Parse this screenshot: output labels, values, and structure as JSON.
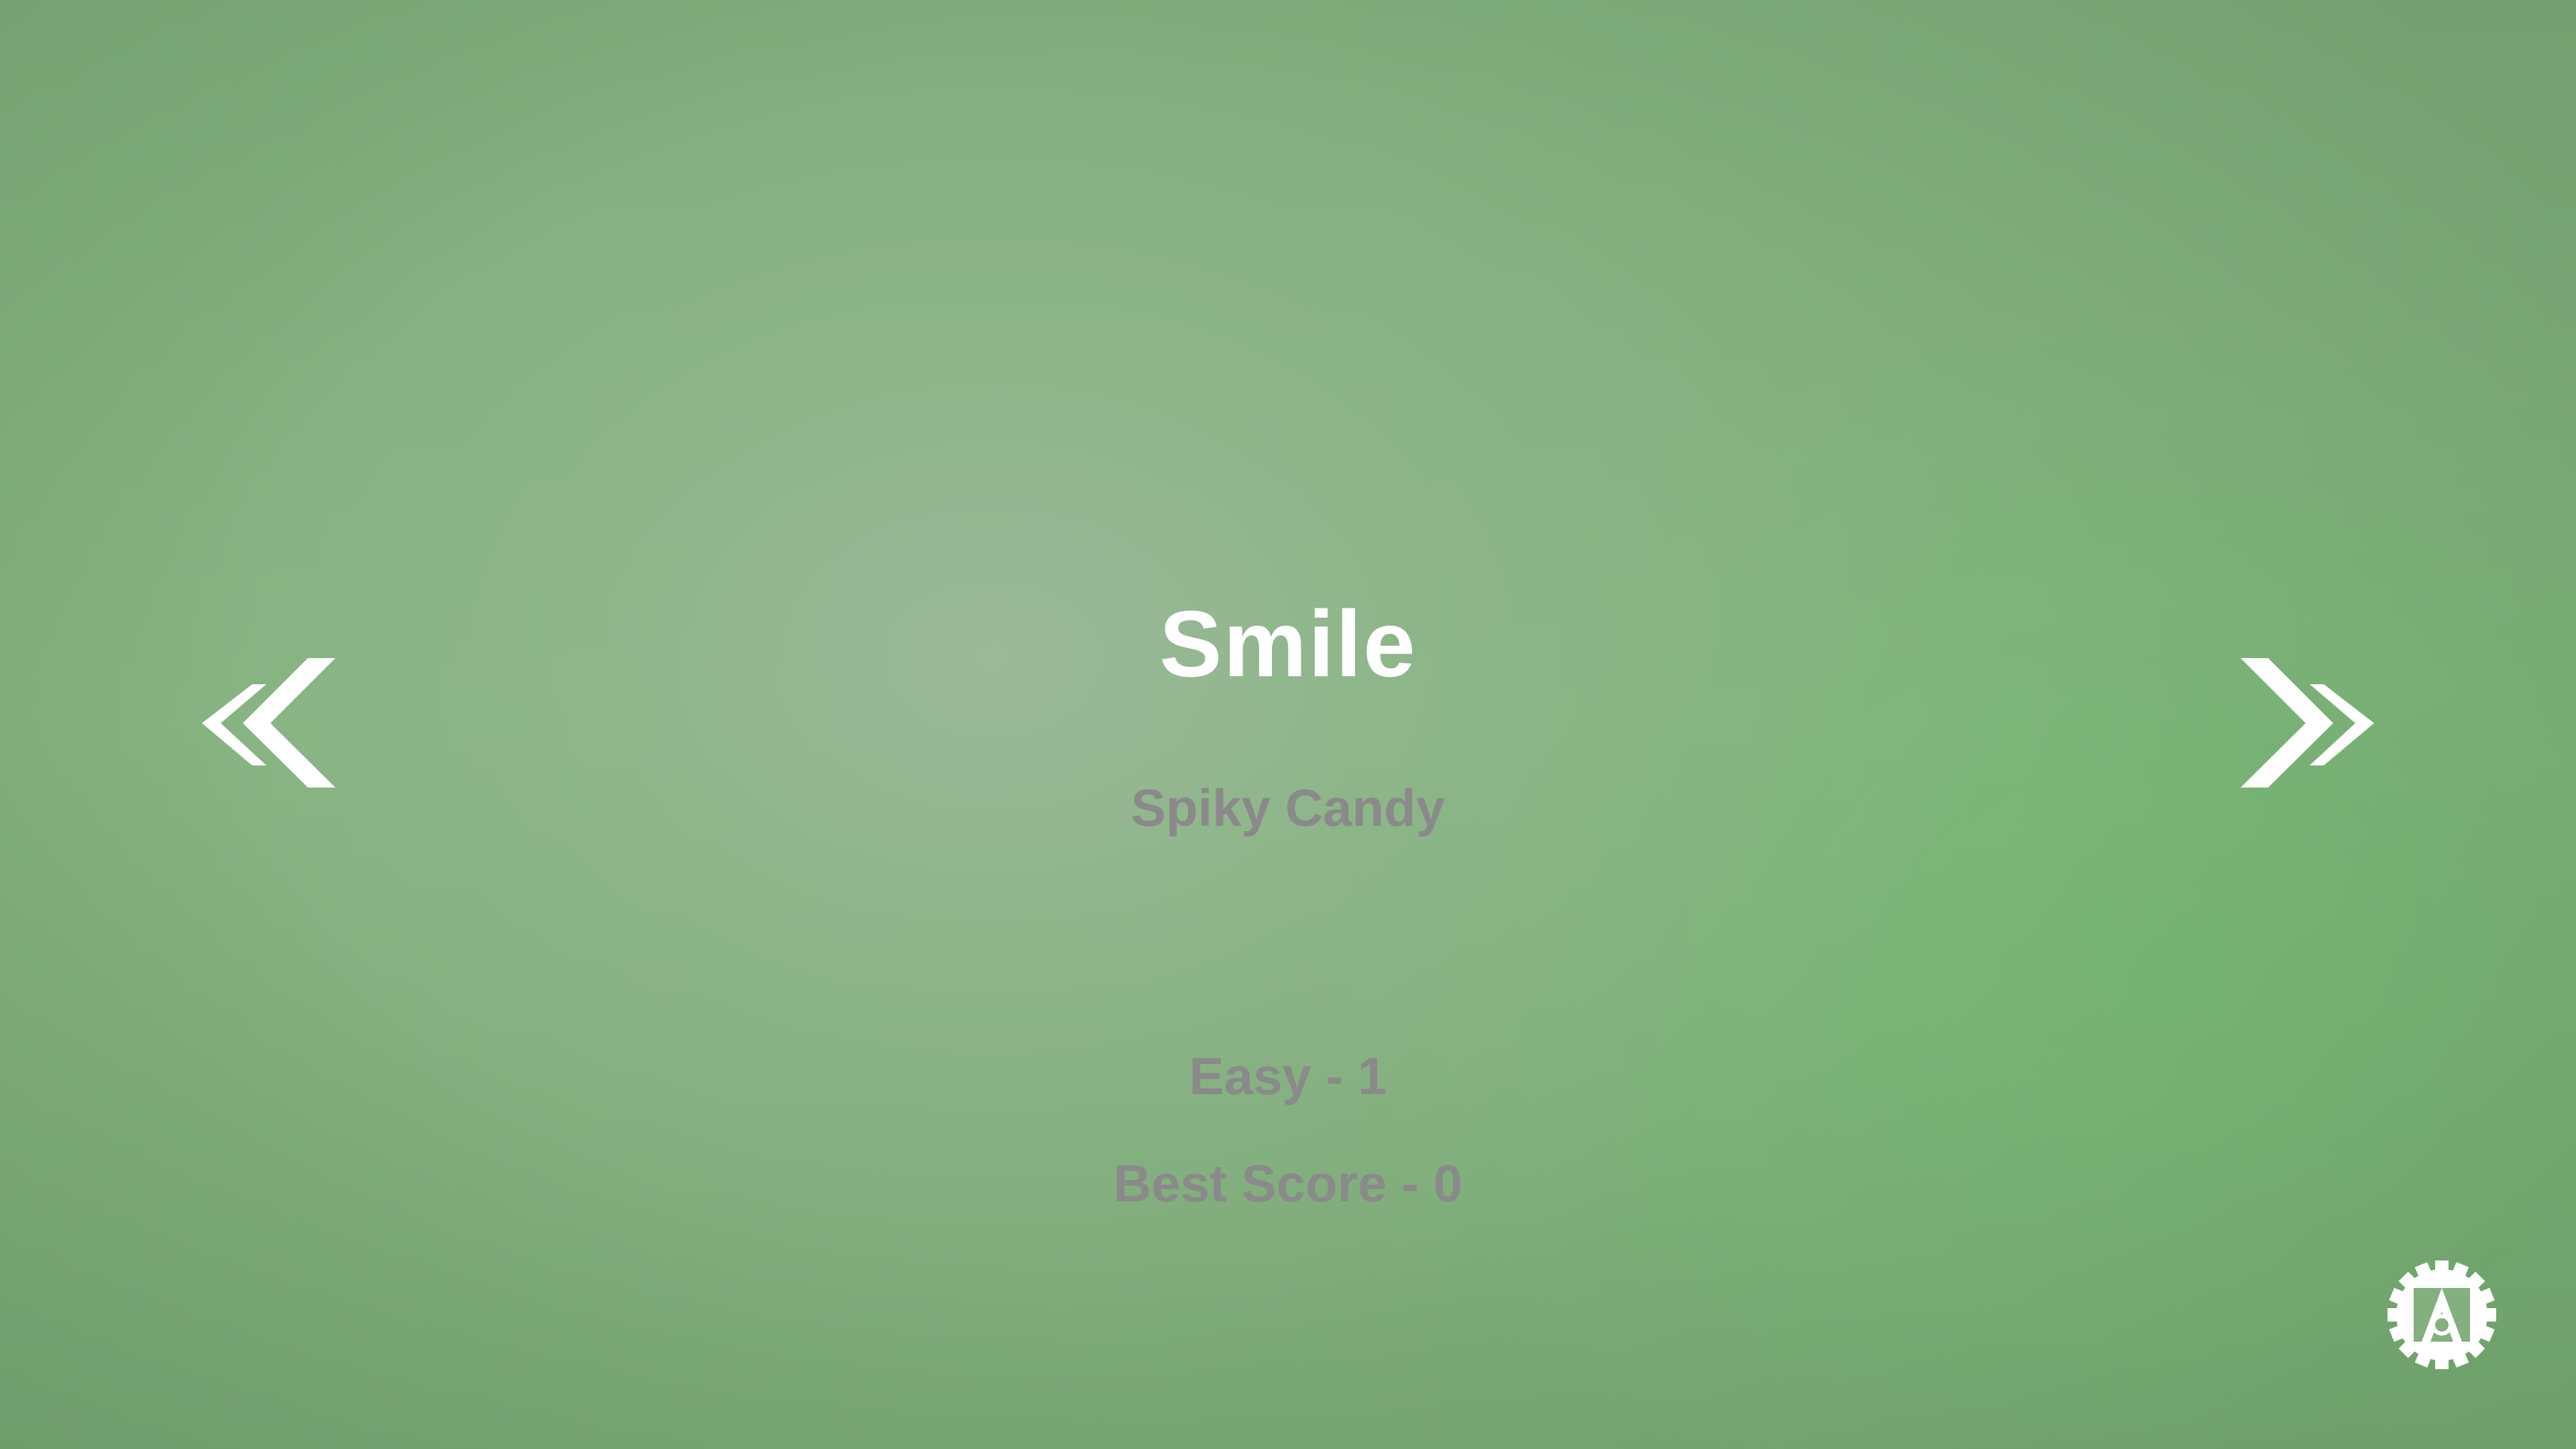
{
  "level": {
    "name": "Smile",
    "author": "Spiky Candy",
    "difficulty": "Easy - 1",
    "best_score": "Best Score - 0"
  },
  "icons": {
    "prev": "double-chevron-left-icon",
    "next": "double-chevron-right-icon",
    "settings": "gear-icon"
  },
  "colors": {
    "background": "#82b07e",
    "title": "#ffffff",
    "secondary_text": "#8a8a8a",
    "icons": "#ffffff"
  }
}
